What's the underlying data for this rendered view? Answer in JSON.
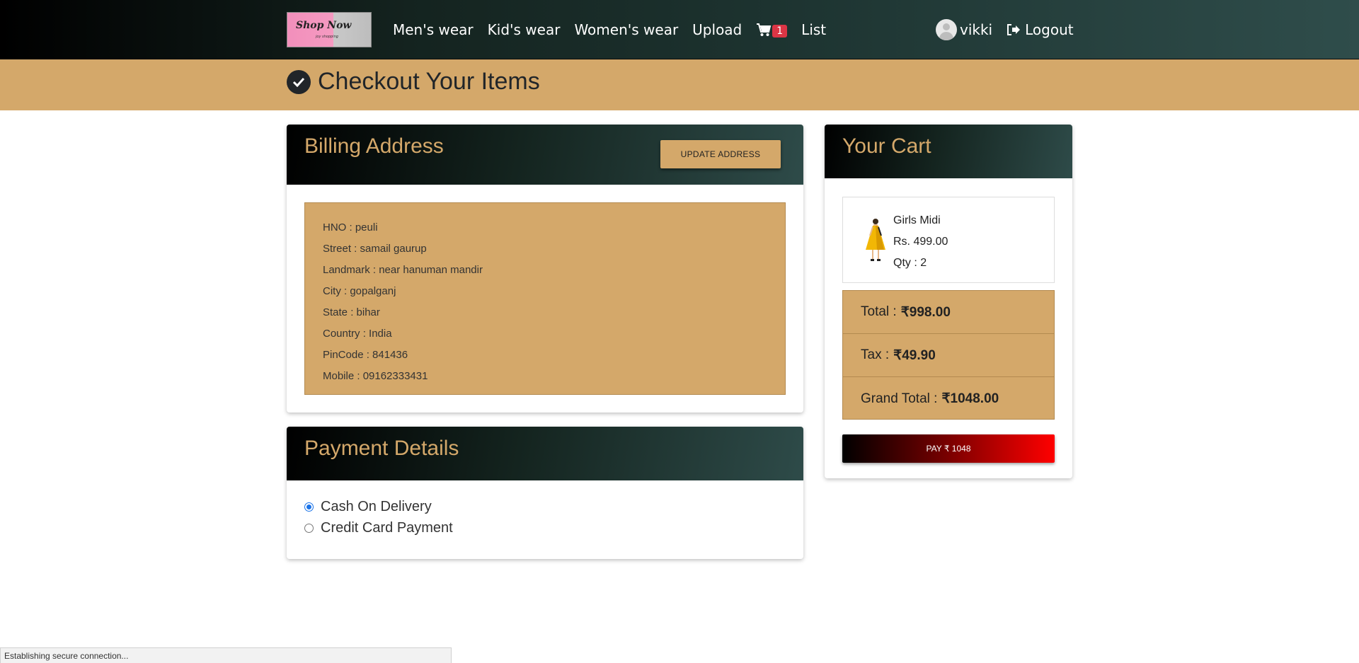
{
  "nav": {
    "logo_text": "Shop Now",
    "logo_subtext": "joy shopping",
    "links": [
      "Men's wear",
      "Kid's wear",
      "Women's wear",
      "Upload"
    ],
    "cart_count": "1",
    "list_label": "List",
    "username": "vikki",
    "logout_label": "Logout"
  },
  "banner": {
    "title": "Checkout Your Items"
  },
  "billing": {
    "title": "Billing Address",
    "update_button": "UPDATE ADDRESS",
    "lines": [
      "HNO : peuli",
      "Street : samail gaurup",
      "Landmark : near hanuman mandir",
      "City : gopalganj",
      "State : bihar",
      "Country : India",
      "PinCode : 841436",
      "Mobile : 09162333431"
    ]
  },
  "payment": {
    "title": "Payment Details",
    "options": [
      "Cash On Delivery",
      "Credit Card Payment"
    ],
    "selected": "Cash On Delivery"
  },
  "cart": {
    "title": "Your Cart",
    "item": {
      "name": "Girls Midi",
      "price": "Rs. 499.00",
      "qty": "Qty : 2"
    },
    "total_label": "Total :",
    "total_value": "₹998.00",
    "tax_label": "Tax :",
    "tax_value": "₹49.90",
    "grand_label": "Grand Total :",
    "grand_value": "₹1048.00",
    "pay_button": "PAY ₹ 1048"
  },
  "status": {
    "text": "Establishing secure connection..."
  },
  "colors": {
    "accent": "#d4a86a",
    "badge": "#dc3545"
  }
}
